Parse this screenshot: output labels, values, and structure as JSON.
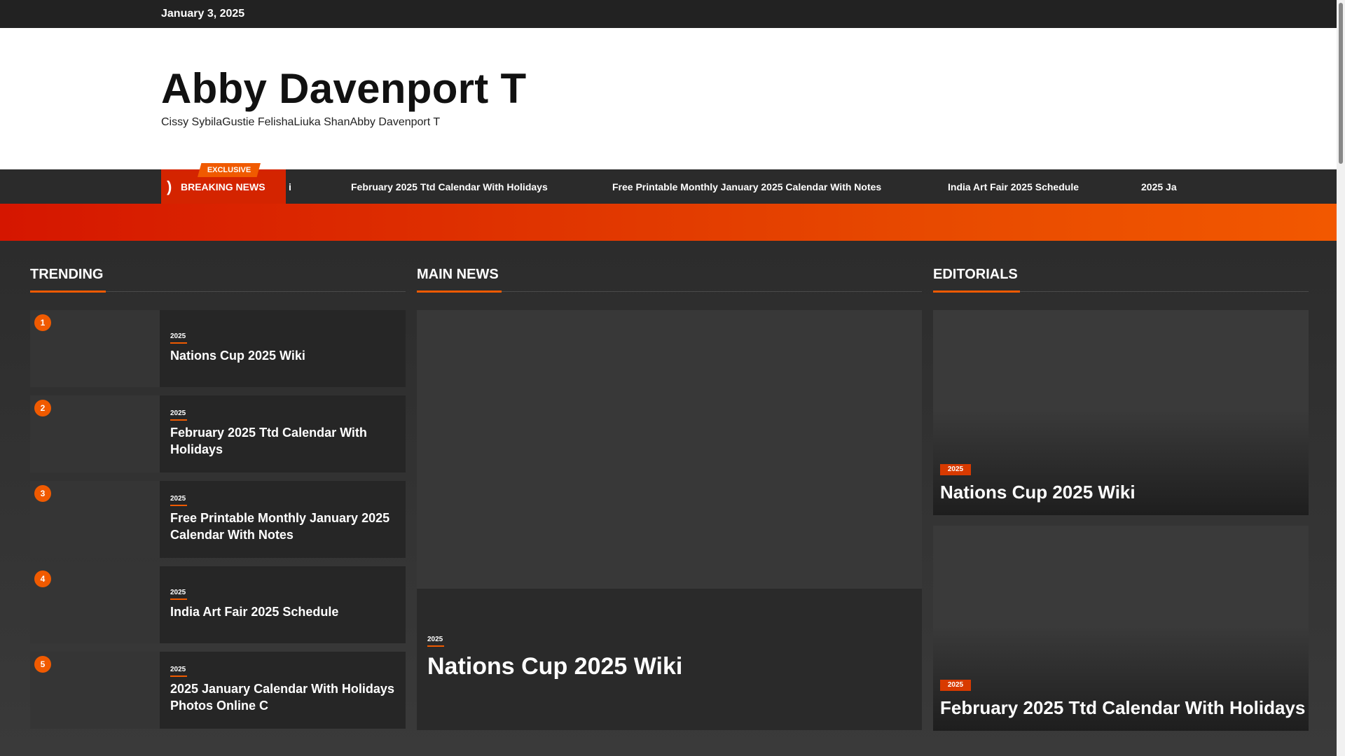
{
  "topbar": {
    "date": "January 3, 2025"
  },
  "header": {
    "site_title": "Abby Davenport T",
    "site_description": "Cissy SybilaGustie FelishaLiuka ShanAbby Davenport T"
  },
  "breaking": {
    "exclusive": "EXCLUSIVE",
    "label": "BREAKING NEWS",
    "ticker": [
      "i",
      "February 2025 Ttd Calendar With Holidays",
      "Free Printable Monthly January 2025 Calendar With Notes",
      "India Art Fair 2025 Schedule",
      "2025 Ja"
    ]
  },
  "trending": {
    "title": "TRENDING",
    "items": [
      {
        "rank": "1",
        "category": "2025",
        "title": "Nations Cup 2025 Wiki"
      },
      {
        "rank": "2",
        "category": "2025",
        "title": "February 2025 Ttd Calendar With Holidays"
      },
      {
        "rank": "3",
        "category": "2025",
        "title": "Free Printable Monthly January 2025 Calendar With Notes"
      },
      {
        "rank": "4",
        "category": "2025",
        "title": "India Art Fair 2025 Schedule"
      },
      {
        "rank": "5",
        "category": "2025",
        "title": "2025 January Calendar With Holidays Photos Online C"
      }
    ]
  },
  "main_news": {
    "title": "MAIN NEWS",
    "category": "2025",
    "headline": "Nations Cup 2025 Wiki"
  },
  "editorials": {
    "title": "EDITORIALS",
    "items": [
      {
        "category": "2025",
        "title": "Nations Cup 2025 Wiki"
      },
      {
        "category": "2025",
        "title": "February 2025 Ttd Calendar With Holidays"
      }
    ]
  },
  "colors": {
    "accent": "#f05a00",
    "breaking_red": "#d42400",
    "dark": "#222222"
  }
}
